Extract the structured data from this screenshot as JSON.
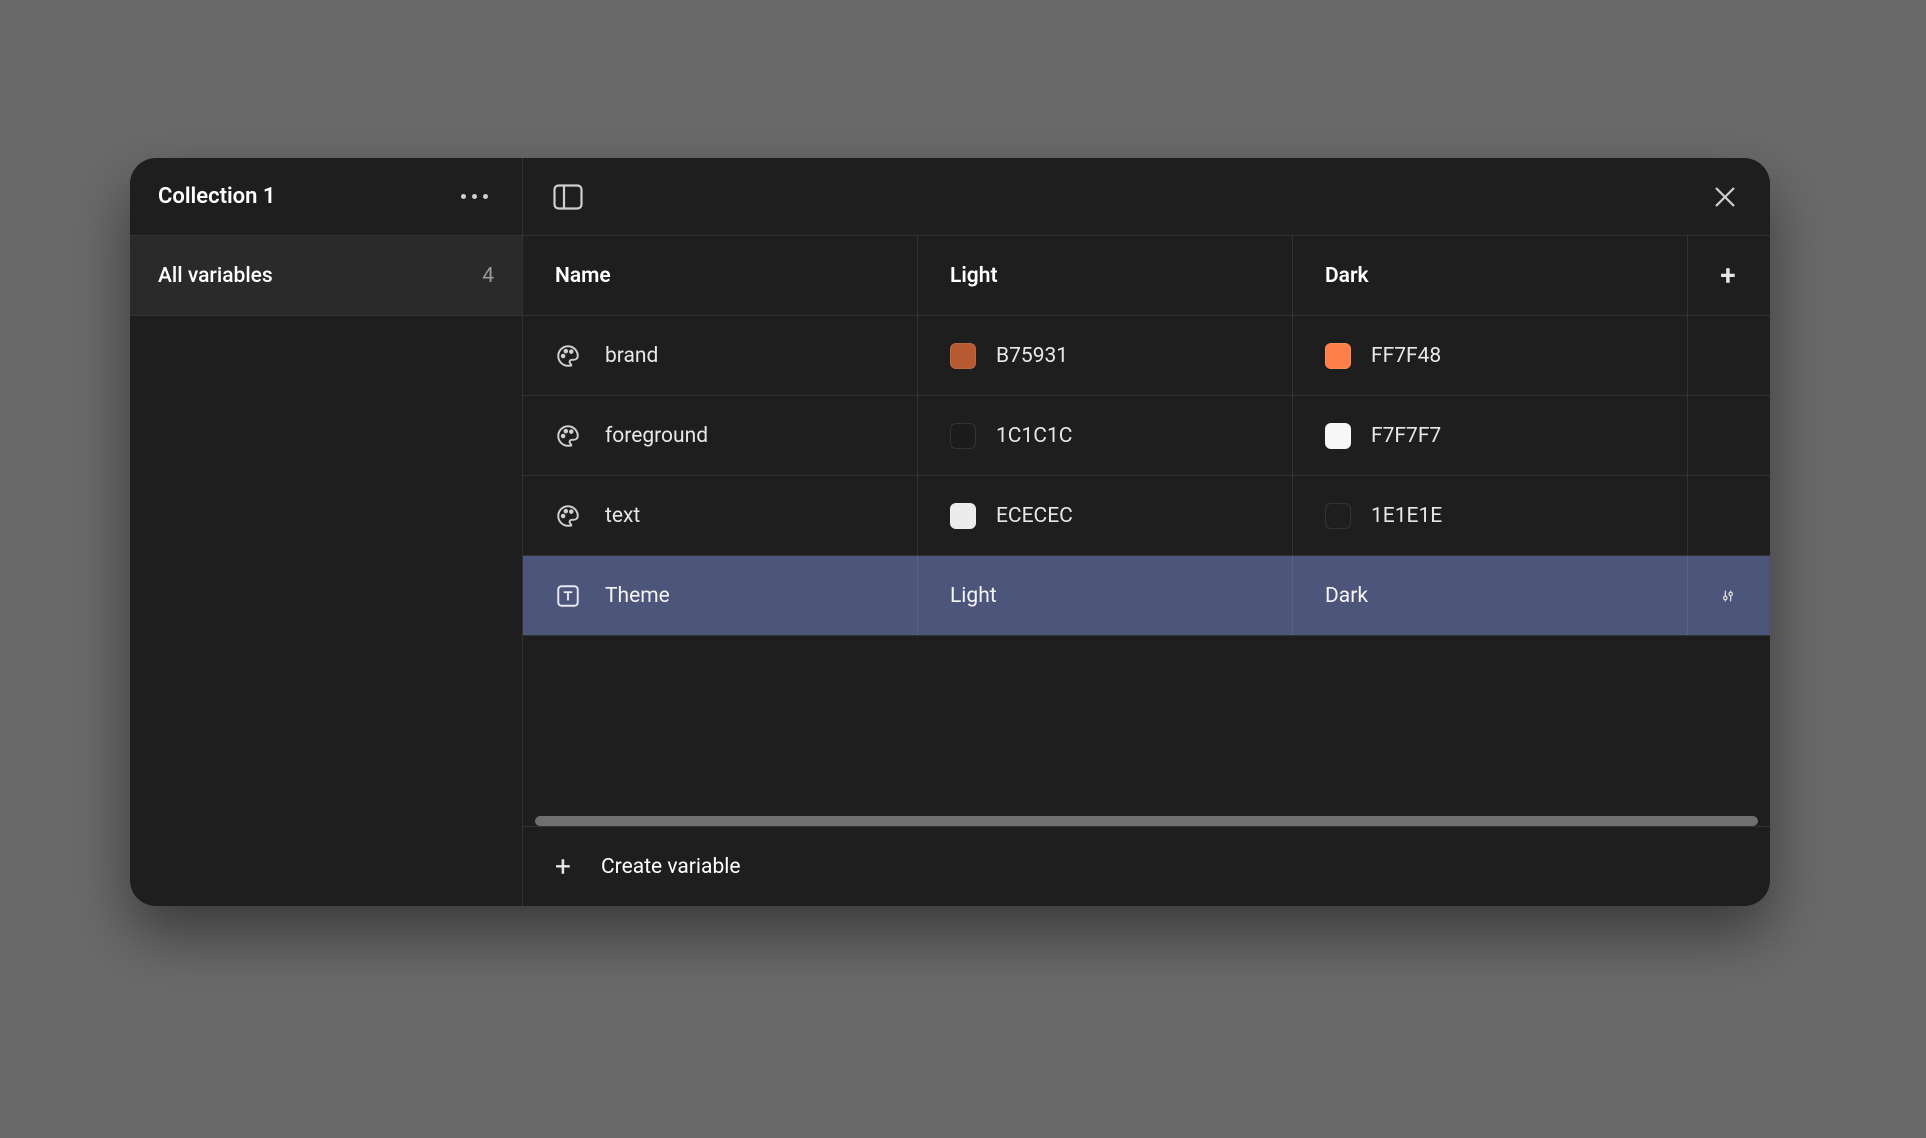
{
  "sidebar": {
    "collection_title": "Collection 1",
    "all_variables_label": "All variables",
    "all_variables_count": "4"
  },
  "columns": {
    "name": "Name",
    "mode1": "Light",
    "mode2": "Dark"
  },
  "rows": [
    {
      "type": "color",
      "name": "brand",
      "mode1_value": "B75931",
      "mode1_swatch": "#B75931",
      "mode2_value": "FF7F48",
      "mode2_swatch": "#FF7F48",
      "selected": false
    },
    {
      "type": "color",
      "name": "foreground",
      "mode1_value": "1C1C1C",
      "mode1_swatch": "#1C1C1C",
      "mode2_value": "F7F7F7",
      "mode2_swatch": "#F7F7F7",
      "selected": false
    },
    {
      "type": "color",
      "name": "text",
      "mode1_value": "ECECEC",
      "mode1_swatch": "#ECECEC",
      "mode2_value": "1E1E1E",
      "mode2_swatch": "#1E1E1E",
      "selected": false
    },
    {
      "type": "string",
      "name": "Theme",
      "mode1_value": "Light",
      "mode2_value": "Dark",
      "selected": true
    }
  ],
  "footer": {
    "create_label": "Create variable"
  }
}
